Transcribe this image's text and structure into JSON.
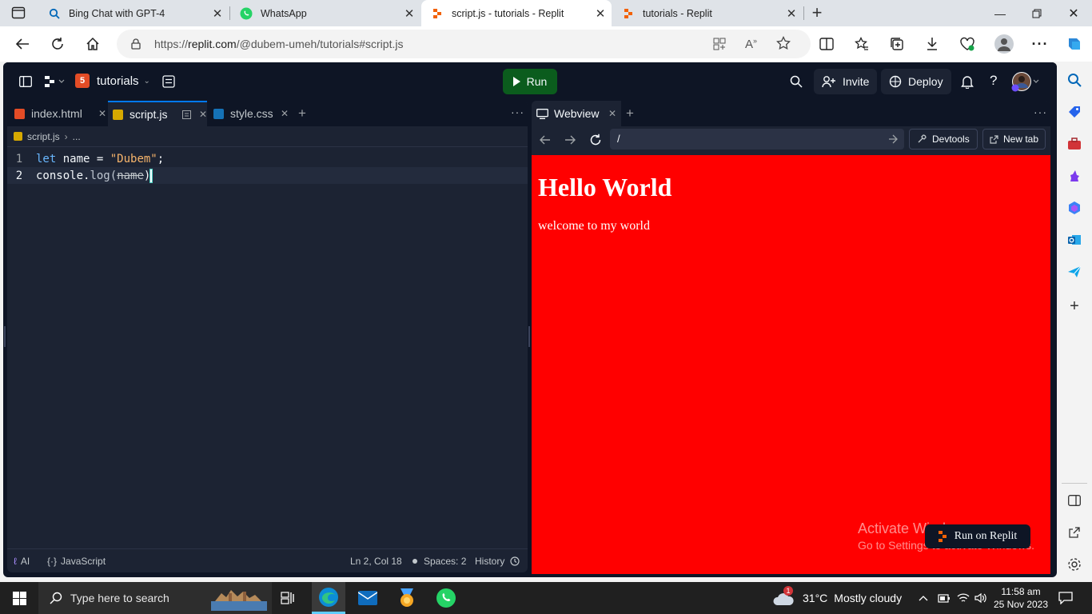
{
  "browser": {
    "tabs": [
      {
        "title": "Bing Chat with GPT-4",
        "icon": "bing-search-icon"
      },
      {
        "title": "WhatsApp",
        "icon": "whatsapp-icon"
      },
      {
        "title": "script.js - tutorials - Replit",
        "icon": "replit-icon",
        "active": true
      },
      {
        "title": "tutorials - Replit",
        "icon": "replit-icon"
      }
    ],
    "new_tab": "+",
    "url_prefix": "https://",
    "url_host": "replit.com",
    "url_path": "/@dubem-umeh/tutorials#script.js"
  },
  "replit": {
    "repl_name": "tutorials",
    "run_label": "Run",
    "invite_label": "Invite",
    "deploy_label": "Deploy",
    "editor_tabs": [
      {
        "name": "index.html",
        "kind": "html"
      },
      {
        "name": "script.js",
        "kind": "js",
        "active": true
      },
      {
        "name": "style.css",
        "kind": "css"
      }
    ],
    "breadcrumb": {
      "file": "script.js",
      "more": "..."
    },
    "code_lines": [
      {
        "n": "1",
        "tokens": [
          {
            "t": "let",
            "c": "kw"
          },
          {
            "t": " name = ",
            "c": "id"
          },
          {
            "t": "\"Dubem\"",
            "c": "str"
          },
          {
            "t": ";",
            "c": "id"
          }
        ]
      },
      {
        "n": "2",
        "tokens": [
          {
            "t": "console",
            "c": "id"
          },
          {
            "t": ".",
            "c": "id"
          },
          {
            "t": "log",
            "c": "fn"
          },
          {
            "t": "(",
            "c": "fn"
          },
          {
            "t": "name",
            "c": "strike"
          },
          {
            "t": ")",
            "c": "id"
          }
        ]
      }
    ],
    "status": {
      "ai": "AI",
      "language": "JavaScript",
      "cursor": "Ln 2, Col 18",
      "spaces": "Spaces: 2",
      "history": "History"
    },
    "webview": {
      "tab_label": "Webview",
      "path": "/",
      "devtools": "Devtools",
      "new_tab": "New tab",
      "heading": "Hello World",
      "paragraph": "welcome to my world",
      "page_bg": "#ff0000",
      "run_on_replit": "Run on Replit",
      "watermark_title": "Activate Windows",
      "watermark_sub": "Go to Settings to activate Windows."
    }
  },
  "taskbar": {
    "search_placeholder": "Type here to search",
    "weather_temp": "31°C",
    "weather_desc": "Mostly cloudy",
    "weather_badge": "1",
    "time": "11:58 am",
    "date": "25 Nov 2023"
  },
  "colors": {
    "accent": "#0079f2",
    "run_green": "#0b5c1d",
    "replit_orange": "#f26207"
  }
}
